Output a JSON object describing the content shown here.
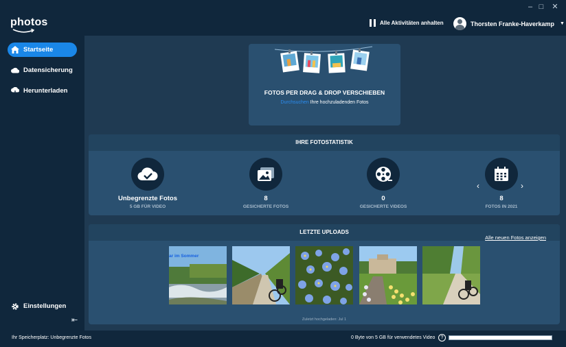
{
  "app": {
    "logo_text": "photos"
  },
  "window_controls": {
    "minimize": "–",
    "maximize": "□",
    "close": "✕"
  },
  "header": {
    "pause_label": "Alle Aktivitäten anhalten",
    "user_name": "Thorsten Franke-Haverkamp"
  },
  "sidebar": {
    "items": [
      {
        "label": "Startseite",
        "icon": "home-icon",
        "active": true
      },
      {
        "label": "Datensicherung",
        "icon": "cloud-icon",
        "active": false
      },
      {
        "label": "Herunterladen",
        "icon": "cloud-download-icon",
        "active": false
      }
    ],
    "settings_label": "Einstellungen",
    "collapse_glyph": "⇤"
  },
  "dropzone": {
    "title": "FOTOS PER DRAG & DROP VERSCHIEBEN",
    "browse_link": "Durchsuchen",
    "subtitle_rest": "Ihre hochzuladenden Fotos"
  },
  "stats": {
    "title": "IHRE FOTOSTATISTIK",
    "items": [
      {
        "value": "Unbegrenzte Fotos",
        "label": "5 GB FÜR VIDEO",
        "icon": "cloud-check-icon"
      },
      {
        "value": "8",
        "label": "GESICHERTE FOTOS",
        "icon": "photos-icon"
      },
      {
        "value": "0",
        "label": "GESICHERTE VIDEOS",
        "icon": "film-reel-icon"
      },
      {
        "value": "8",
        "label": "FOTOS IN 2021",
        "icon": "calendar-icon"
      }
    ]
  },
  "uploads": {
    "title": "LETZTE UPLOADS",
    "see_all": "Alle neuen Fotos anzeigen",
    "first_caption": "ar im Sommer",
    "last_upload": "Zuletzt hochgeladen: Jul 1"
  },
  "status": {
    "storage": "Ihr Speicherplatz: Unbegrenzte Fotos",
    "usage": "0 Byte von 5 GB für verwendetes Video",
    "help": "?",
    "video_usage_fraction": 0.0
  },
  "colors": {
    "accent": "#1a87e8",
    "panel": "#2a5070",
    "dark": "#10273c",
    "background": "#1f3a52"
  }
}
